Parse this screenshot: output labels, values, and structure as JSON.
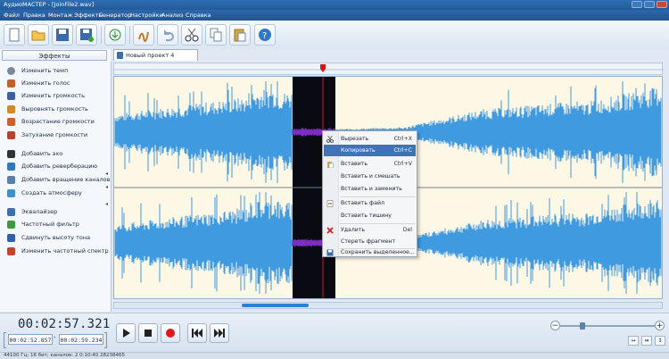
{
  "window": {
    "title": "АудиоМАСТЕР - [JoinFile2.wav]"
  },
  "menu": [
    "Файл",
    "Правка",
    "Монтаж",
    "Эффекты",
    "Генератор",
    "Настройки",
    "Анализ",
    "Справка"
  ],
  "toolbar": {
    "icons": [
      "new-file-icon",
      "open-folder-icon",
      "save-icon",
      "save-as-icon",
      "record-icon",
      "effects-icon",
      "undo-icon",
      "cut-icon",
      "copy-icon",
      "paste-icon",
      "help-icon"
    ]
  },
  "effects_panel": {
    "title": "Эффекты",
    "items": [
      {
        "label": "Изменить темп",
        "icon": "tempo-icon",
        "color": "#7a8a9c"
      },
      {
        "label": "Изменить голос",
        "icon": "voice-icon",
        "color": "#c0622c"
      },
      {
        "label": "Изменить громкость",
        "icon": "volume-icon",
        "color": "#3b5fa0"
      },
      {
        "label": "Выровнять громкость",
        "icon": "normalize-icon",
        "color": "#d08a26"
      },
      {
        "label": "Возрастание громкости",
        "icon": "fade-in-icon",
        "color": "#d15f2a"
      },
      {
        "label": "Затухание громкости",
        "icon": "fade-out-icon",
        "color": "#b8432c"
      },
      {
        "label": "Добавить эхо",
        "icon": "echo-icon",
        "color": "#333333"
      },
      {
        "label": "Добавить реверберацию",
        "icon": "reverb-icon",
        "color": "#2f78c4"
      },
      {
        "label": "Добавить вращение каналов",
        "icon": "rotate-channels-icon",
        "color": "#5a7fa8"
      },
      {
        "label": "Создать атмосферу",
        "icon": "atmosphere-icon",
        "color": "#3f8fd0"
      },
      {
        "label": "Эквалайзер",
        "icon": "equalizer-icon",
        "color": "#3d6fb0"
      },
      {
        "label": "Частотный фильтр",
        "icon": "filter-icon",
        "color": "#3c9a3c"
      },
      {
        "label": "Сдвинуть высоту тона",
        "icon": "pitch-icon",
        "color": "#3060a8"
      },
      {
        "label": "Изменить частотный спектр",
        "icon": "spectrum-icon",
        "color": "#c0462a"
      }
    ]
  },
  "tab": {
    "label": "Новый проект 4"
  },
  "context_menu": {
    "items": [
      {
        "label": "Вырезать",
        "shortcut": "Ctrl+X",
        "icon": "cut-icon"
      },
      {
        "label": "Копировать",
        "shortcut": "Ctrl+C",
        "icon": "",
        "highlighted": true
      },
      {
        "label": "Вставить",
        "shortcut": "Ctrl+V",
        "icon": "paste-icon"
      },
      {
        "label": "Вставить и смешать",
        "shortcut": "",
        "icon": ""
      },
      {
        "label": "Вставить и заменить",
        "shortcut": "",
        "icon": ""
      },
      {
        "label": "Вставить файл",
        "shortcut": "",
        "icon": "insert-file-icon"
      },
      {
        "label": "Вставить тишину",
        "shortcut": "",
        "icon": ""
      },
      {
        "label": "Удалить",
        "shortcut": "Del",
        "icon": "delete-icon"
      },
      {
        "label": "Стереть фрагмент",
        "shortcut": "",
        "icon": ""
      },
      {
        "label": "Сохранить выделенное...",
        "shortcut": "",
        "icon": "save-selection-icon"
      }
    ]
  },
  "transport": {
    "current_time": "00:02:57.321",
    "selection_start": "00:02:52.857",
    "selection_dash": "-",
    "selection_end": "00:02:59.234",
    "buttons": [
      "play-icon",
      "stop-icon",
      "record-icon",
      "skip-back-icon",
      "skip-forward-icon"
    ]
  },
  "zoom": {
    "minus": "−",
    "plus": "+"
  },
  "status": {
    "text": "44100 Гц; 16 бит; каналов: 2   0:10:40 28238465"
  },
  "colors": {
    "waveform": "#3f9ae0",
    "selection": "#7a2fc0",
    "background": "#fdf7e6",
    "playhead": "#d01818",
    "menu_highlight": "#3d73b8"
  }
}
